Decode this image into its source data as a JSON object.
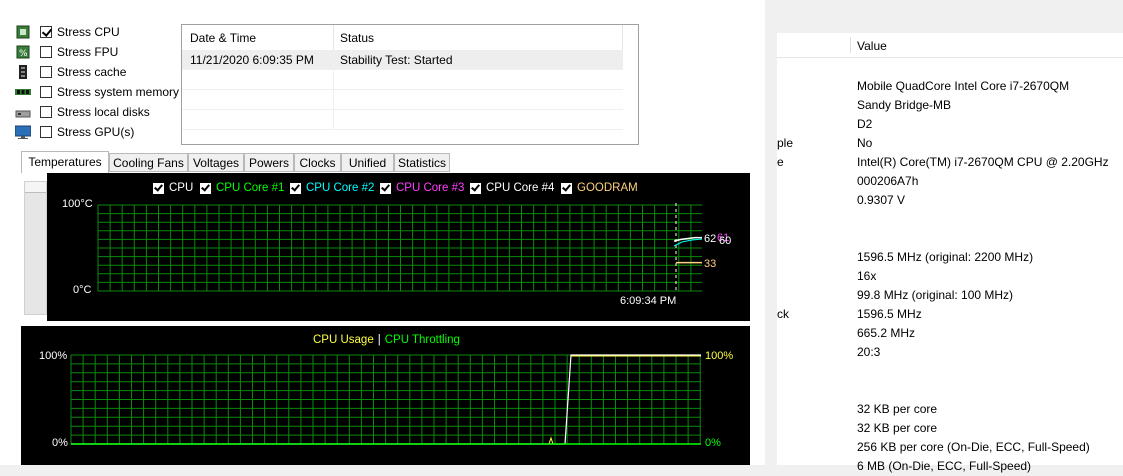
{
  "stress_options": [
    {
      "label": "Stress CPU",
      "checked": true,
      "icon": "cpu-icon"
    },
    {
      "label": "Stress FPU",
      "checked": false,
      "icon": "fpu-icon"
    },
    {
      "label": "Stress cache",
      "checked": false,
      "icon": "cache-icon"
    },
    {
      "label": "Stress system memory",
      "checked": false,
      "icon": "memory-icon"
    },
    {
      "label": "Stress local disks",
      "checked": false,
      "icon": "disk-icon"
    },
    {
      "label": "Stress GPU(s)",
      "checked": false,
      "icon": "gpu-icon"
    }
  ],
  "log": {
    "columns": [
      "Date & Time",
      "Status"
    ],
    "rows": [
      {
        "datetime": "11/21/2020 6:09:35 PM",
        "status": "Stability Test: Started"
      }
    ]
  },
  "tabs": [
    "Temperatures",
    "Cooling Fans",
    "Voltages",
    "Powers",
    "Clocks",
    "Unified",
    "Statistics"
  ],
  "active_tab": "Temperatures",
  "temp_graph": {
    "legend": [
      {
        "label": "CPU",
        "color": "#ffffff"
      },
      {
        "label": "CPU Core #1",
        "color": "#00ff00"
      },
      {
        "label": "CPU Core #2",
        "color": "#00ffff"
      },
      {
        "label": "CPU Core #3",
        "color": "#ff40ff"
      },
      {
        "label": "CPU Core #4",
        "color": "#ffffff"
      },
      {
        "label": "GOODRAM",
        "color": "#ffd080"
      }
    ],
    "y_max": "100°C",
    "y_min": "0°C",
    "time_label": "6:09:34 PM",
    "readings": [
      "62",
      "61",
      "60",
      "33"
    ],
    "reading_colors": [
      "#ffffff",
      "#ff40ff",
      "#ffffff",
      "#ffd080"
    ]
  },
  "usage_graph": {
    "legend": [
      {
        "label": "CPU Usage",
        "color": "#ffff40"
      },
      {
        "label": "|",
        "color": "#ffffff"
      },
      {
        "label": "CPU Throttling",
        "color": "#00ff00"
      }
    ],
    "y_max": "100%",
    "y_min": "0%",
    "right_max": "100%",
    "right_min": "0%"
  },
  "chart_data": [
    {
      "type": "line",
      "title": "",
      "series": [
        {
          "name": "CPU",
          "values": [
            58,
            60,
            61,
            62,
            62
          ]
        },
        {
          "name": "GOODRAM",
          "values": [
            33,
            33
          ]
        }
      ],
      "ylim": [
        0,
        100
      ]
    },
    {
      "type": "line",
      "title": "",
      "series": [
        {
          "name": "CPU Usage",
          "values": [
            0,
            0,
            100,
            100
          ]
        },
        {
          "name": "CPU Throttling",
          "values": [
            0,
            0,
            0,
            0
          ]
        }
      ],
      "ylim": [
        0,
        100
      ]
    }
  ],
  "properties": {
    "header_value": "Value",
    "header_fragment": "",
    "rows": [
      {
        "field": "",
        "value": "Mobile QuadCore Intel Core i7-2670QM"
      },
      {
        "field": "",
        "value": "Sandy Bridge-MB"
      },
      {
        "field": "",
        "value": "D2"
      },
      {
        "field": "ple",
        "value": "No"
      },
      {
        "field": "e",
        "value": "Intel(R) Core(TM) i7-2670QM CPU @ 2.20GHz"
      },
      {
        "field": "",
        "value": "000206A7h"
      },
      {
        "field": "",
        "value": "0.9307 V"
      },
      {
        "field": "",
        "value": "1596.5 MHz  (original: 2200 MHz)"
      },
      {
        "field": "",
        "value": "16x"
      },
      {
        "field": "",
        "value": "99.8 MHz  (original: 100 MHz)"
      },
      {
        "field": "ck",
        "value": "1596.5 MHz"
      },
      {
        "field": "",
        "value": "665.2 MHz"
      },
      {
        "field": "",
        "value": "20:3"
      },
      {
        "field": "",
        "value": "32 KB per core"
      },
      {
        "field": "",
        "value": "32 KB per core"
      },
      {
        "field": "",
        "value": "256 KB per core  (On-Die, ECC, Full-Speed)"
      },
      {
        "field": "",
        "value": "6 MB  (On-Die, ECC, Full-Speed)"
      }
    ]
  }
}
